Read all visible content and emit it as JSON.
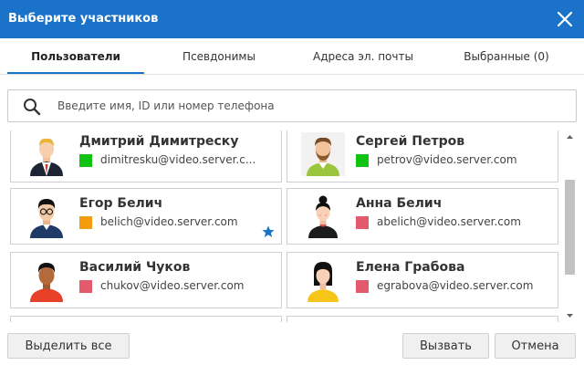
{
  "dialog": {
    "title": "Выберите участников"
  },
  "tabs": [
    {
      "label": "Пользователи",
      "active": true
    },
    {
      "label": "Псевдонимы"
    },
    {
      "label": "Адреса эл. почты"
    },
    {
      "label": "Выбранные (0)"
    }
  ],
  "search": {
    "placeholder": "Введите имя, ID или номер телефона",
    "value": ""
  },
  "contacts": [
    {
      "name": "Дмитрий Димитреску",
      "email": "dimitresku@video.server.c...",
      "status": "online",
      "favorite": false,
      "avatar": "businessman-avatar"
    },
    {
      "name": "Сергей Петров",
      "email": "petrov@video.server.com",
      "status": "online",
      "favorite": false,
      "avatar": "bearded-man-avatar"
    },
    {
      "name": "Егор Белич",
      "email": "belich@video.server.com",
      "status": "away",
      "favorite": true,
      "avatar": "man-glasses-avatar"
    },
    {
      "name": "Анна Белич",
      "email": "abelich@video.server.com",
      "status": "offline",
      "favorite": false,
      "avatar": "woman-bun-avatar"
    },
    {
      "name": "Василий Чуков",
      "email": "chukov@video.server.com",
      "status": "offline",
      "favorite": false,
      "avatar": "man-red-shirt-avatar"
    },
    {
      "name": "Елена Грабова",
      "email": "egrabova@video.server.com",
      "status": "offline",
      "favorite": false,
      "avatar": "woman-yellow-avatar"
    }
  ],
  "colors": {
    "accent": "#1a73c8",
    "status_online": "#13c313",
    "status_away": "#f49c0c",
    "status_offline": "#e25a6b",
    "favorite_star": "#1a73c8"
  },
  "buttons": {
    "select_all": "Выделить все",
    "call": "Вызвать",
    "cancel": "Отмена"
  }
}
